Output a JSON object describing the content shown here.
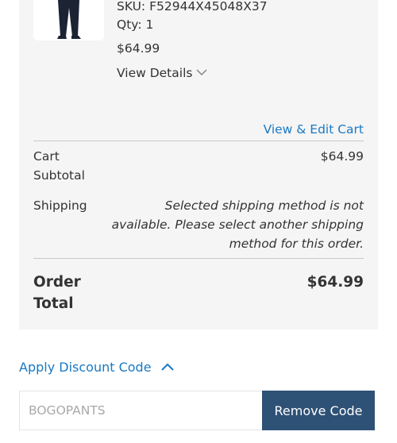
{
  "item": {
    "sku_text": "SKU: F52944X45048X37",
    "qty_text": "Qty: 1",
    "price": "$64.99",
    "view_details_label": "View Details"
  },
  "cart": {
    "view_edit_label": "View & Edit Cart"
  },
  "totals": {
    "subtotal_label": "Cart Subtotal",
    "subtotal_value": "$64.99",
    "shipping_label": "Shipping",
    "shipping_message": "Selected shipping method is not available. Please select another shipping method for this order.",
    "order_total_label": "Order Total",
    "order_total_value": "$64.99"
  },
  "discount": {
    "toggle_label": "Apply Discount Code",
    "code_placeholder": "BOGOPANTS",
    "remove_label": "Remove Code"
  },
  "colors": {
    "link": "#1979c3",
    "button_bg": "#2e5176",
    "panel_bg": "#f5f5f5"
  },
  "icons": {
    "details_toggle": "chevron-down-icon",
    "discount_toggle": "chevron-up-icon"
  }
}
